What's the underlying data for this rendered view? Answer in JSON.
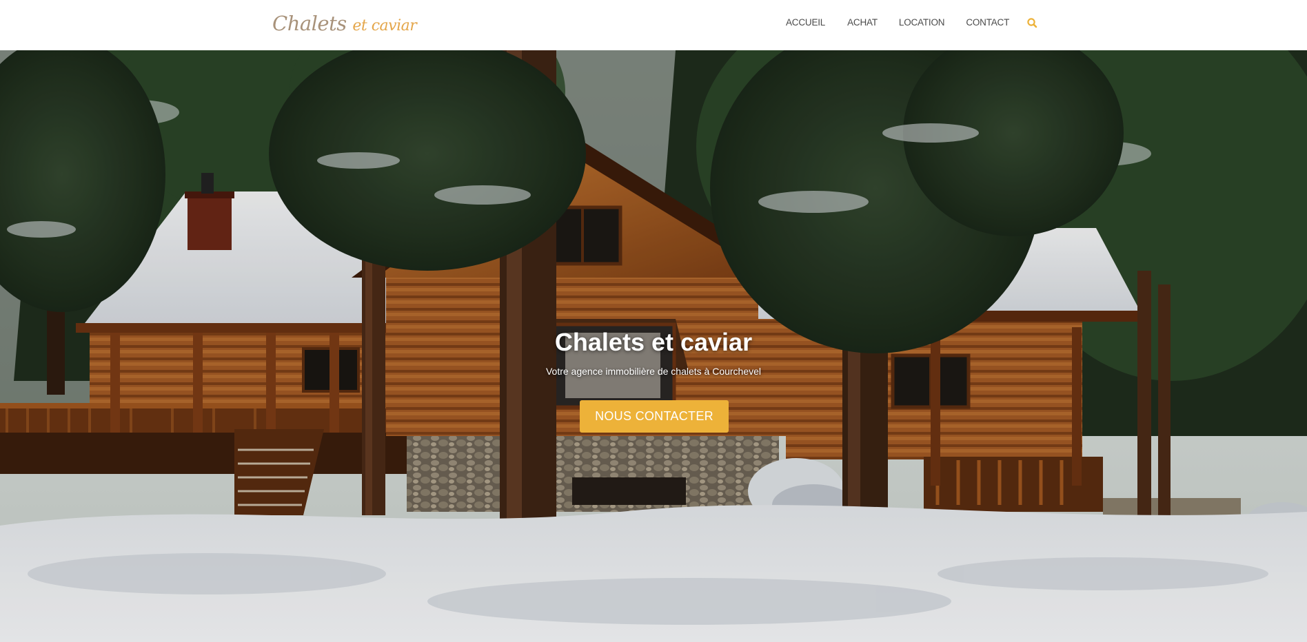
{
  "header": {
    "logo": {
      "word1": "Chalets",
      "word2": "et caviar"
    },
    "nav": [
      {
        "label": "ACCUEIL"
      },
      {
        "label": "ACHAT"
      },
      {
        "label": "LOCATION"
      },
      {
        "label": "CONTACT"
      }
    ],
    "search_icon": "search-icon"
  },
  "hero": {
    "title": "Chalets et caviar",
    "subtitle": "Votre agence immobilière de chalets à Courchevel",
    "cta_label": "NOUS CONTACTER",
    "background": "log-cabin-in-snowy-pine-forest"
  },
  "colors": {
    "accent": "#edb239",
    "logo_primary": "#a8927a",
    "logo_secondary": "#e4a64a",
    "nav_text": "#4a4a4a"
  }
}
